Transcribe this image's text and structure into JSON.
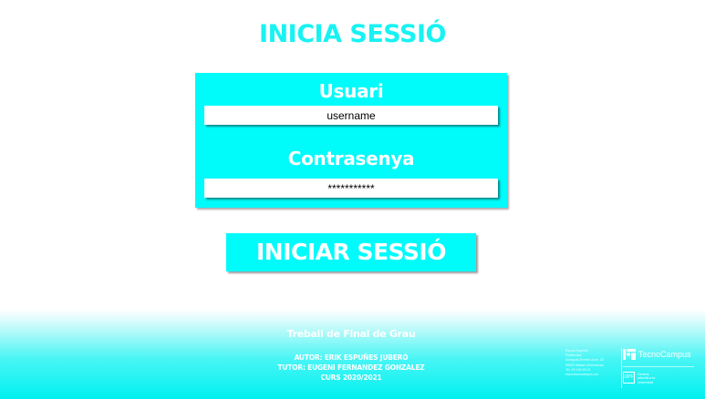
{
  "page": {
    "title": "INICIA SESSIÓ"
  },
  "login": {
    "user_label": "Usuari",
    "user_value": "username",
    "password_label": "Contrasenya",
    "password_value": "***********",
    "submit_label": "INICIAR SESSIÓ"
  },
  "footer": {
    "title": "Treball de Final de Grau",
    "author": "AUTOR: ERIK ESPUÑES JUBERÓ",
    "tutor": "TUTOR: EUGENI FERNANDEZ GONZALEZ",
    "course": "CURS 2020/2021",
    "org_address": [
      "Escola Superior",
      "Politècnica",
      "Avinguda Ernest Lluch, 32",
      "08302 Mataró (Barcelona)",
      "Tel. 93 169 65 01",
      "www.tecnocampus.cat"
    ],
    "org_logo_text": "TecnoCampus",
    "univ_badge": "UPF",
    "univ_text": [
      "Centres",
      "adscrits a la",
      "Universitat"
    ]
  },
  "colors": {
    "accent": "#00fbfb",
    "title": "#19f2f2",
    "text_on_accent": "#ffffff"
  }
}
